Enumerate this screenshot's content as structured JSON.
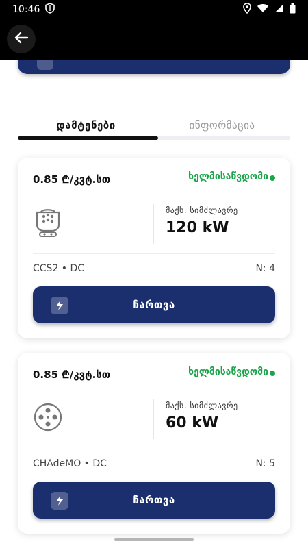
{
  "status_bar": {
    "time": "10:46"
  },
  "tabs": [
    {
      "label": "დამტენები",
      "active": true
    },
    {
      "label": "ინფორმაცია",
      "active": false
    }
  ],
  "connectors": [
    {
      "price": "0.85 ₾/კვტ.სთ",
      "status": "ხელმისაწვდომი",
      "max_power_label": "მაქს. სიმძლავრე",
      "max_power_value": "120 kW",
      "type": "CCS2 • DC",
      "number": "N: 4",
      "icon": "ccs2-connector-icon",
      "button_label": "ჩართვა"
    },
    {
      "price": "0.85 ₾/კვტ.სთ",
      "status": "ხელმისაწვდომი",
      "max_power_label": "მაქს. სიმძლავრე",
      "max_power_value": "60 kW",
      "type": "CHAdeMO • DC",
      "number": "N: 5",
      "icon": "chademo-connector-icon",
      "button_label": "ჩართვა"
    }
  ],
  "colors": {
    "primary": "#1b2f6e",
    "available": "#1aa54a"
  }
}
